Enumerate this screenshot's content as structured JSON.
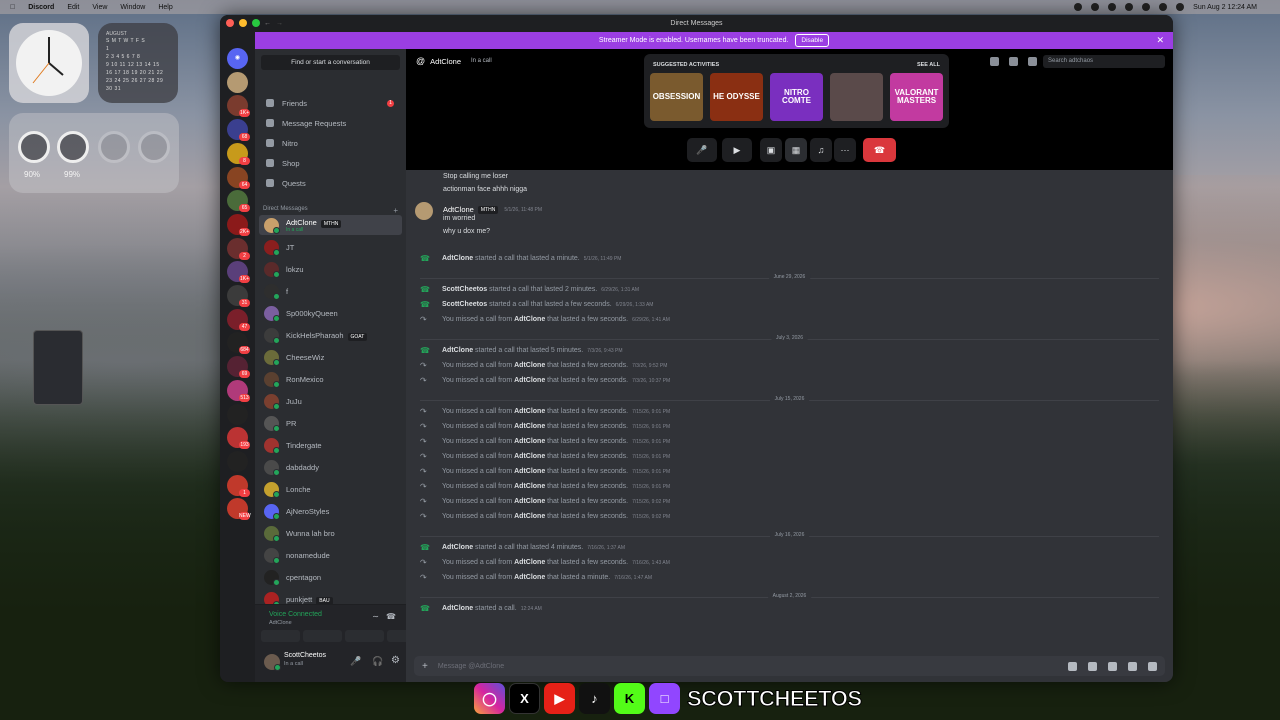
{
  "menubar": {
    "app": "Discord",
    "items": [
      "Edit",
      "View",
      "Window",
      "Help"
    ],
    "clock": "Sun Aug 2  12:24 AM"
  },
  "widgets": {
    "calendar_month": "AUGUST",
    "calendar_days": "S M T W T F S",
    "calendar_rows": [
      "1",
      "2 3 4 5 6 7 8",
      "9 10 11 12 13 14 15",
      "16 17 18 19 20 21 22",
      "23 24 25 26 27 28 29",
      "30 31"
    ],
    "battery": [
      "90%",
      "99%"
    ]
  },
  "window": {
    "title": "Direct Messages"
  },
  "banner": {
    "text": "Streamer Mode is enabled. Usernames have been truncated.",
    "button": "Disable"
  },
  "servers": [
    {
      "badge": ""
    },
    {
      "badge": ""
    },
    {
      "badge": "1K+"
    },
    {
      "badge": "68"
    },
    {
      "badge": "8"
    },
    {
      "badge": "64"
    },
    {
      "badge": "65"
    },
    {
      "badge": "2K+"
    },
    {
      "badge": "2"
    },
    {
      "badge": "1K+"
    },
    {
      "badge": "31"
    },
    {
      "badge": "47"
    },
    {
      "badge": "684"
    },
    {
      "badge": "69"
    },
    {
      "badge": "513"
    },
    {
      "badge": ""
    },
    {
      "badge": "193"
    },
    {
      "badge": ""
    },
    {
      "badge": "1"
    },
    {
      "badge": "NEW"
    }
  ],
  "sidebar": {
    "find": "Find or start a conversation",
    "nav": [
      {
        "label": "Friends",
        "badge": "1"
      },
      {
        "label": "Message Requests",
        "badge": ""
      },
      {
        "label": "Nitro",
        "badge": ""
      },
      {
        "label": "Shop",
        "badge": ""
      },
      {
        "label": "Quests",
        "badge": ""
      }
    ],
    "dm_header": "Direct Messages",
    "add": "+",
    "dms": [
      {
        "name": "AdtClone",
        "tag": "MTHN",
        "sub": "In a call"
      },
      {
        "name": "JT",
        "tag": "",
        "sub": ""
      },
      {
        "name": "lokzu",
        "tag": "",
        "sub": ""
      },
      {
        "name": "f",
        "tag": "",
        "sub": ""
      },
      {
        "name": "Sp000kyQueen",
        "tag": "",
        "sub": ""
      },
      {
        "name": "KickHelsPharaoh",
        "tag": "GOAT",
        "sub": ""
      },
      {
        "name": "CheeseWiz",
        "tag": "",
        "sub": ""
      },
      {
        "name": "RonMexico",
        "tag": "",
        "sub": ""
      },
      {
        "name": "JuJu",
        "tag": "",
        "sub": ""
      },
      {
        "name": "PR",
        "tag": "",
        "sub": ""
      },
      {
        "name": "Tindergate",
        "tag": "",
        "sub": ""
      },
      {
        "name": "dabdaddy",
        "tag": "",
        "sub": ""
      },
      {
        "name": "Lonche",
        "tag": "",
        "sub": ""
      },
      {
        "name": "AjNeroStyles",
        "tag": "",
        "sub": ""
      },
      {
        "name": "Wunna lah bro",
        "tag": "",
        "sub": ""
      },
      {
        "name": "nonamedude",
        "tag": "",
        "sub": ""
      },
      {
        "name": "cpentagon",
        "tag": "",
        "sub": ""
      },
      {
        "name": "punkjett",
        "tag": "BAU",
        "sub": ""
      }
    ],
    "voice": {
      "status": "Voice Connected",
      "channel": "AdtClone"
    },
    "user": {
      "name": "ScottCheetos",
      "status": "In a call"
    }
  },
  "header": {
    "name": "AdtClone",
    "status": "In a call",
    "search_placeholder": "Search adtchaos"
  },
  "activities": {
    "title": "SUGGESTED ACTIVITIES",
    "see_all": "SEE ALL",
    "tiles": [
      {
        "label": "OBSESSION",
        "color": "#7a5a2e"
      },
      {
        "label": "HE ODYSSE",
        "color": "#8a2f12"
      },
      {
        "label": "NITRO COMTE",
        "color": "#7a2fbf"
      },
      {
        "label": "",
        "color": "#5a4a4a"
      },
      {
        "label": "VALORANT MASTERS",
        "color": "#c23aa0"
      }
    ]
  },
  "messages": {
    "top": [
      "Stop calling me loser",
      "actionman face ahhh nigga"
    ],
    "post": {
      "author": "AdtClone",
      "tag": "MTHN",
      "time": "5/1/26, 11:48 PM",
      "lines": [
        "im worried",
        "why u dox me?"
      ]
    },
    "log": [
      {
        "type": "call",
        "a": "AdtClone",
        "text": "started a call that lasted a minute.",
        "ts": "5/1/26, 11:49 PM"
      },
      {
        "type": "date",
        "text": "June 29, 2026"
      },
      {
        "type": "call",
        "a": "ScottCheetos",
        "text": "started a call that lasted 2 minutes.",
        "ts": "6/29/26, 1:31 AM"
      },
      {
        "type": "call",
        "a": "ScottCheetos",
        "text": "started a call that lasted a few seconds.",
        "ts": "6/29/26, 1:33 AM"
      },
      {
        "type": "miss",
        "a": "AdtClone",
        "text": "that lasted a few seconds.",
        "ts": "6/29/26, 1:41 AM"
      },
      {
        "type": "date",
        "text": "July 3, 2026"
      },
      {
        "type": "call",
        "a": "AdtClone",
        "text": "started a call that lasted 5 minutes.",
        "ts": "7/3/26, 9:43 PM"
      },
      {
        "type": "miss",
        "a": "AdtClone",
        "text": "that lasted a few seconds.",
        "ts": "7/3/26, 9:52 PM"
      },
      {
        "type": "miss",
        "a": "AdtClone",
        "text": "that lasted a few seconds.",
        "ts": "7/3/26, 10:37 PM"
      },
      {
        "type": "date",
        "text": "July 15, 2026"
      },
      {
        "type": "miss",
        "a": "AdtClone",
        "text": "that lasted a few seconds.",
        "ts": "7/15/26, 9:01 PM"
      },
      {
        "type": "miss",
        "a": "AdtClone",
        "text": "that lasted a few seconds.",
        "ts": "7/15/26, 9:01 PM"
      },
      {
        "type": "miss",
        "a": "AdtClone",
        "text": "that lasted a few seconds.",
        "ts": "7/15/26, 9:01 PM"
      },
      {
        "type": "miss",
        "a": "AdtClone",
        "text": "that lasted a few seconds.",
        "ts": "7/15/26, 9:01 PM"
      },
      {
        "type": "miss",
        "a": "AdtClone",
        "text": "that lasted a few seconds.",
        "ts": "7/15/26, 9:01 PM"
      },
      {
        "type": "miss",
        "a": "AdtClone",
        "text": "that lasted a few seconds.",
        "ts": "7/15/26, 9:01 PM"
      },
      {
        "type": "miss",
        "a": "AdtClone",
        "text": "that lasted a few seconds.",
        "ts": "7/15/26, 9:02 PM"
      },
      {
        "type": "miss",
        "a": "AdtClone",
        "text": "that lasted a few seconds.",
        "ts": "7/15/26, 9:02 PM"
      },
      {
        "type": "date",
        "text": "July 16, 2026"
      },
      {
        "type": "call",
        "a": "AdtClone",
        "text": "started a call that lasted 4 minutes.",
        "ts": "7/16/26, 1:37 AM"
      },
      {
        "type": "miss",
        "a": "AdtClone",
        "text": "that lasted a few seconds.",
        "ts": "7/16/26, 1:43 AM"
      },
      {
        "type": "miss",
        "a": "AdtClone",
        "text": "that lasted a minute.",
        "ts": "7/16/26, 1:47 AM"
      },
      {
        "type": "date",
        "text": "August 2, 2026"
      },
      {
        "type": "call",
        "a": "AdtClone",
        "text": "started a call.",
        "ts": "12:24 AM"
      }
    ],
    "missed_prefix": "You missed a call from"
  },
  "composer": {
    "placeholder": "Message @AdtClone"
  },
  "overlay": {
    "handle": "SCOTTCHEETOS"
  }
}
